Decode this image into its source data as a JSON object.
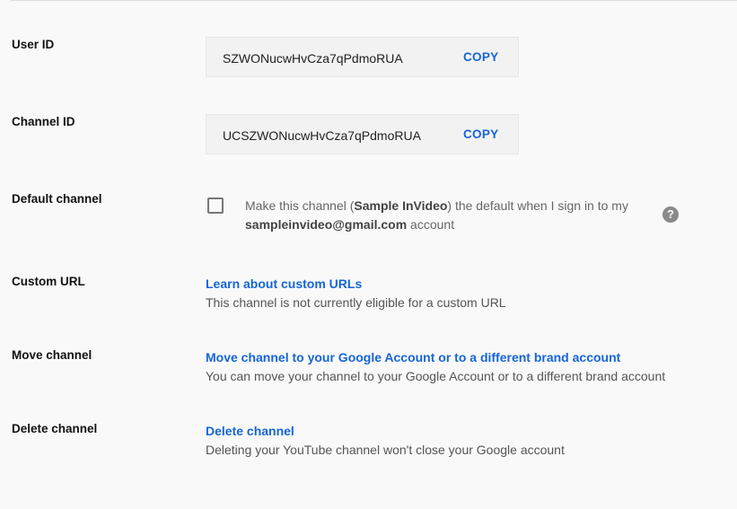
{
  "user_id": {
    "label": "User ID",
    "value": "SZWONucwHvCza7qPdmoRUA",
    "copy_label": "COPY"
  },
  "channel_id": {
    "label": "Channel ID",
    "value": "UCSZWONucwHvCza7qPdmoRUA",
    "copy_label": "COPY"
  },
  "default_channel": {
    "label": "Default channel",
    "checked": false,
    "text_before": "Make this channel (",
    "channel_name": "Sample InVideo",
    "text_middle": ") the default when I sign in to my",
    "email": "sampleinvideo@gmail.com",
    "text_after": " account",
    "help_icon": "?"
  },
  "custom_url": {
    "label": "Custom URL",
    "link": "Learn about custom URLs",
    "description": "This channel is not currently eligible for a custom URL"
  },
  "move_channel": {
    "label": "Move channel",
    "link": "Move channel to your Google Account or to a different brand account",
    "description": "You can move your channel to your Google Account or to a different brand account"
  },
  "delete_channel": {
    "label": "Delete channel",
    "link": "Delete channel",
    "description": "Deleting your YouTube channel won't close your Google account"
  }
}
